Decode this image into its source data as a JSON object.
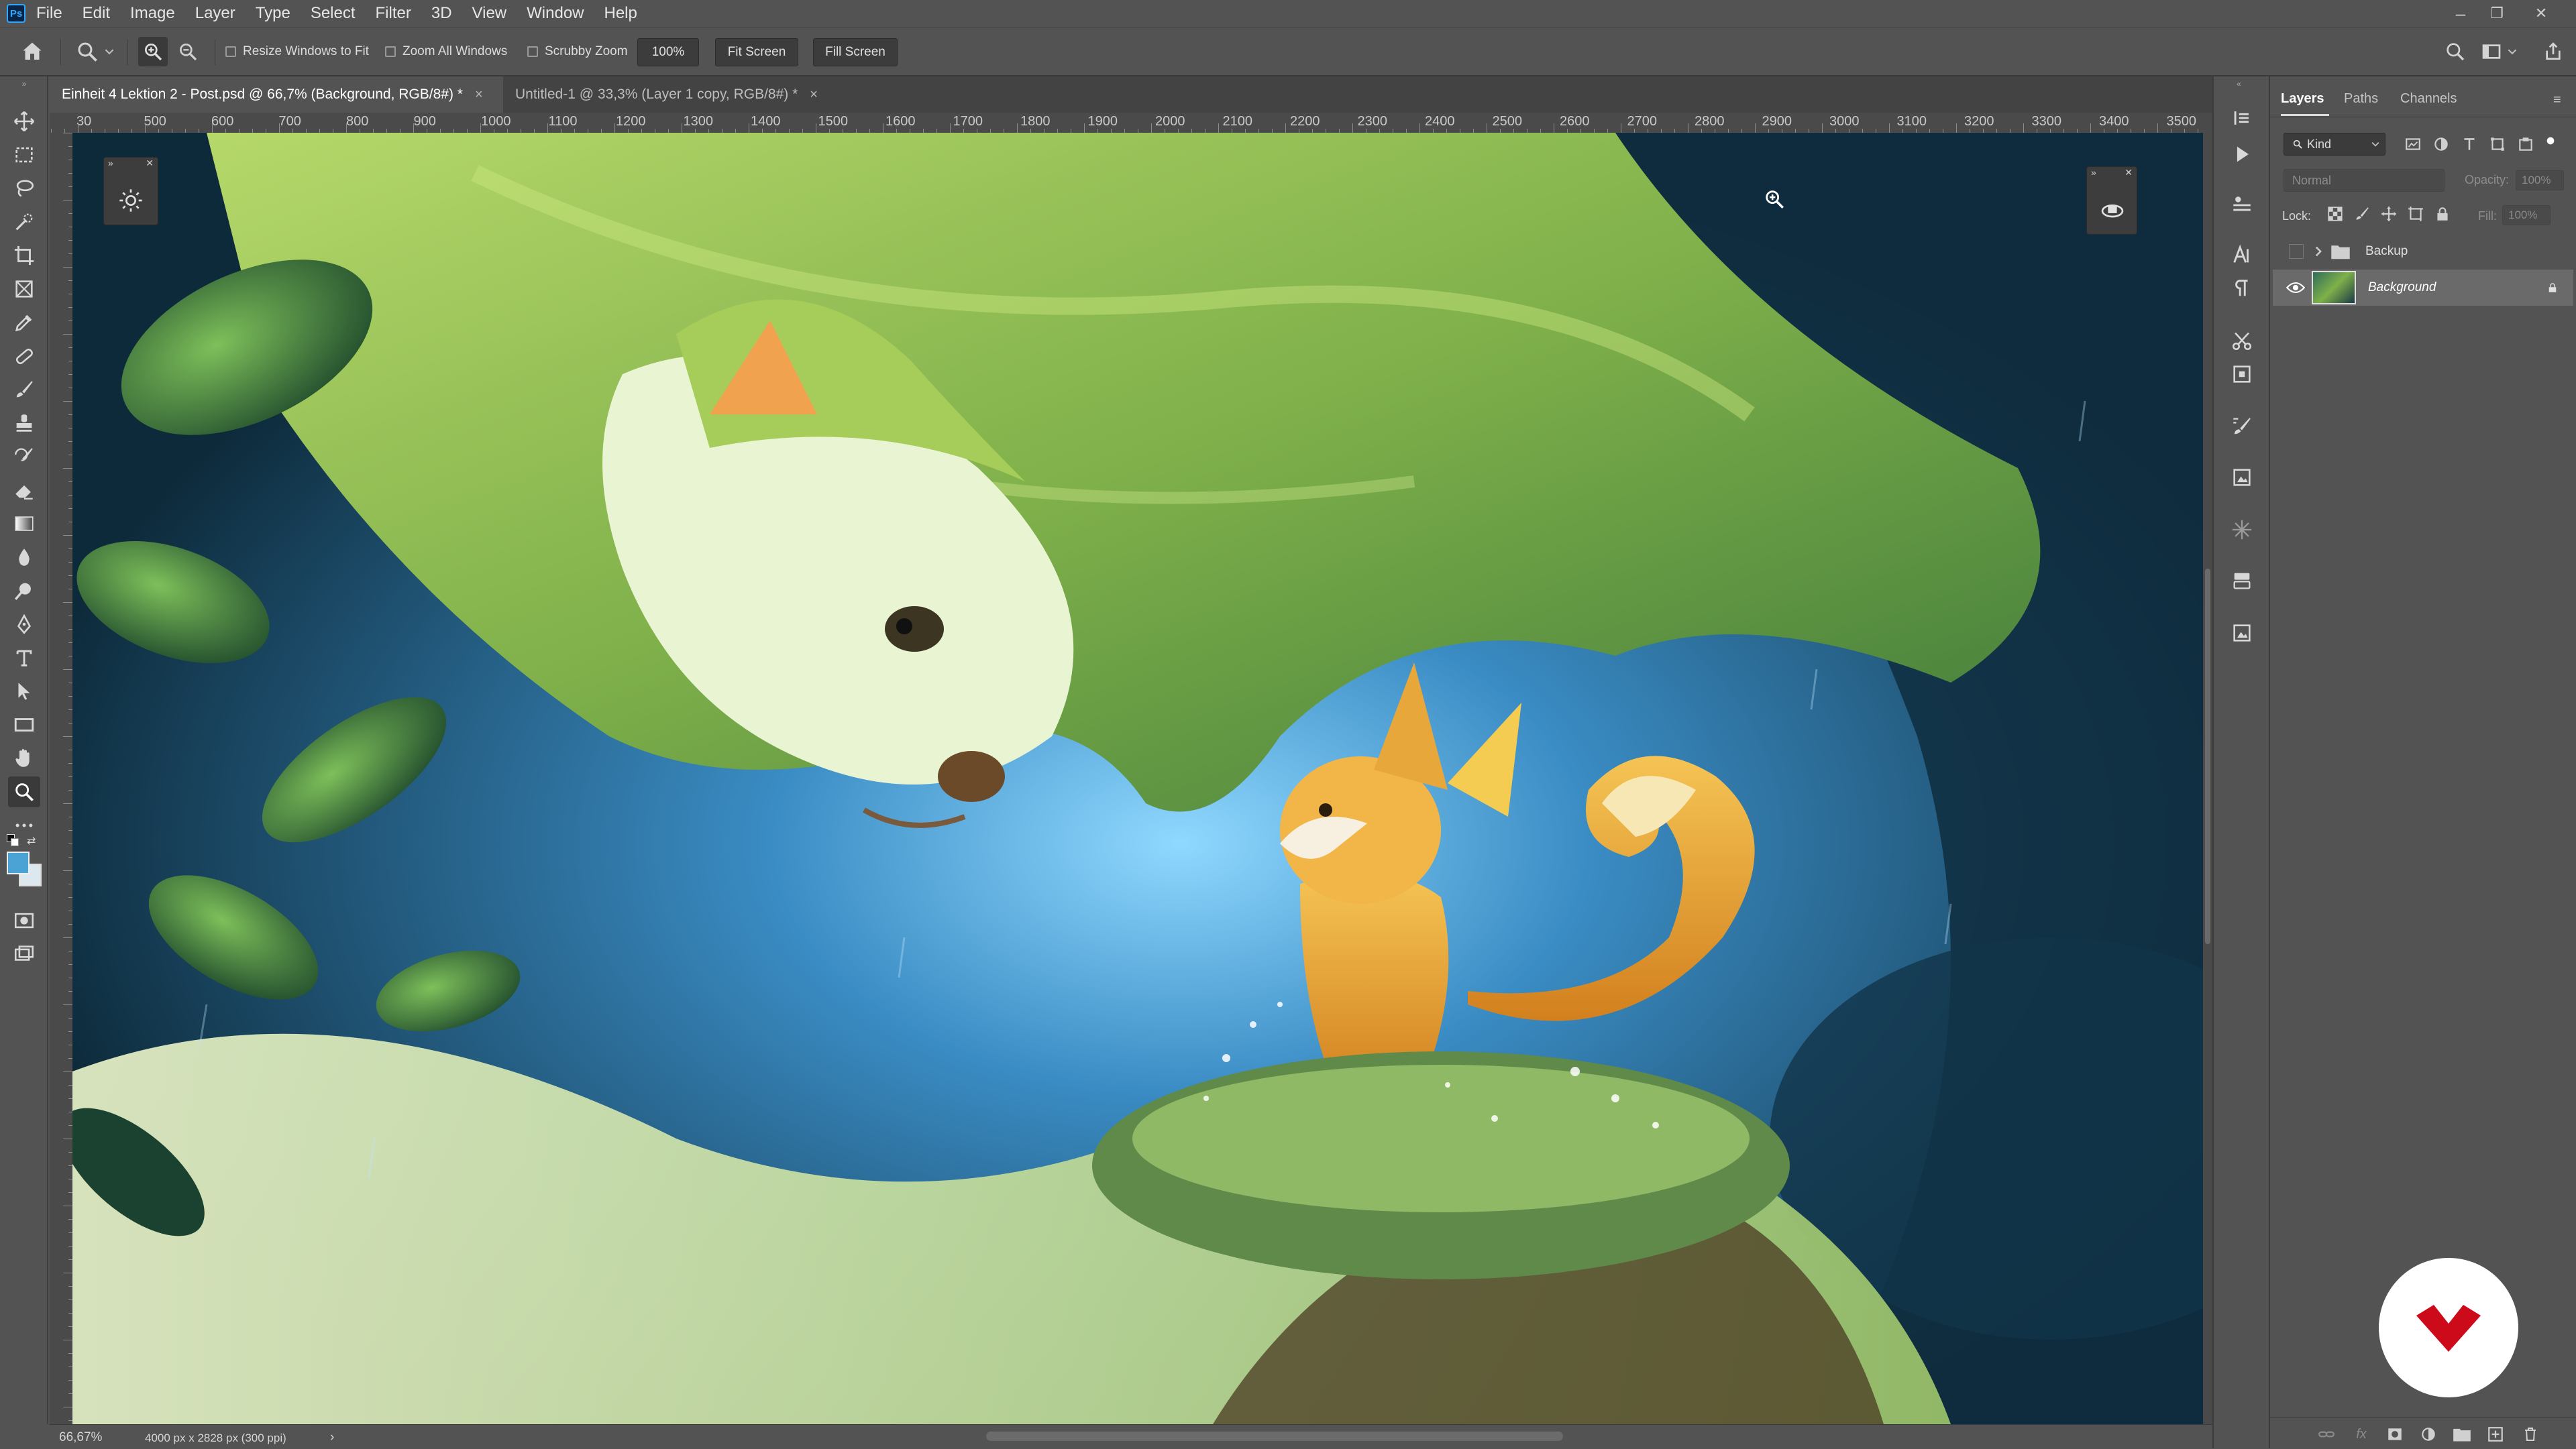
{
  "app": {
    "logo_text": "Ps",
    "menu": [
      "File",
      "Edit",
      "Image",
      "Layer",
      "Type",
      "Select",
      "Filter",
      "3D",
      "View",
      "Window",
      "Help"
    ]
  },
  "window_controls": {
    "minimize": "–",
    "restore": "❐",
    "close": "✕"
  },
  "options_bar": {
    "resize_windows_label": "Resize Windows to Fit",
    "zoom_all_label": "Zoom All Windows",
    "scrubby_label": "Scrubby Zoom",
    "zoom_value": "100%",
    "fit_screen_label": "Fit Screen",
    "fill_screen_label": "Fill Screen"
  },
  "tabs": [
    {
      "title": "Einheit 4 Lektion 2 - Post.psd @ 66,7% (Background, RGB/8#) *",
      "close": "×"
    },
    {
      "title": "Untitled-1 @ 33,3% (Layer 1 copy, RGB/8#) *",
      "close": "×"
    }
  ],
  "ruler_labels": [
    "30",
    "500",
    "600",
    "700",
    "800",
    "900",
    "1000",
    "1100",
    "1200",
    "1300",
    "1400",
    "1500",
    "1600",
    "1700",
    "1800",
    "1900",
    "2000",
    "2100",
    "2200",
    "2300",
    "2400",
    "2500",
    "2600",
    "2700",
    "2800",
    "2900",
    "3000",
    "3100",
    "3200",
    "3300",
    "3400",
    "3500"
  ],
  "status": {
    "zoom": "66,67%",
    "doc_size": "4000 px x 2828 px (300 ppi)",
    "arrow": "›"
  },
  "layers_panel": {
    "tabs": [
      "Layers",
      "Paths",
      "Channels"
    ],
    "filter_kind": "Kind",
    "blend_mode": "Normal",
    "opacity_label": "Opacity:",
    "opacity_value": "100%",
    "lock_label": "Lock:",
    "fill_label": "Fill:",
    "fill_value": "100%",
    "layers": [
      {
        "name": "Backup",
        "type": "group",
        "visible": false
      },
      {
        "name": "Background",
        "type": "pixel",
        "visible": true,
        "locked": true,
        "selected": true
      }
    ]
  },
  "colors": {
    "foreground": "#4aa3d4",
    "background": "#dce8ee",
    "badge_red": "#cc0a1a"
  }
}
